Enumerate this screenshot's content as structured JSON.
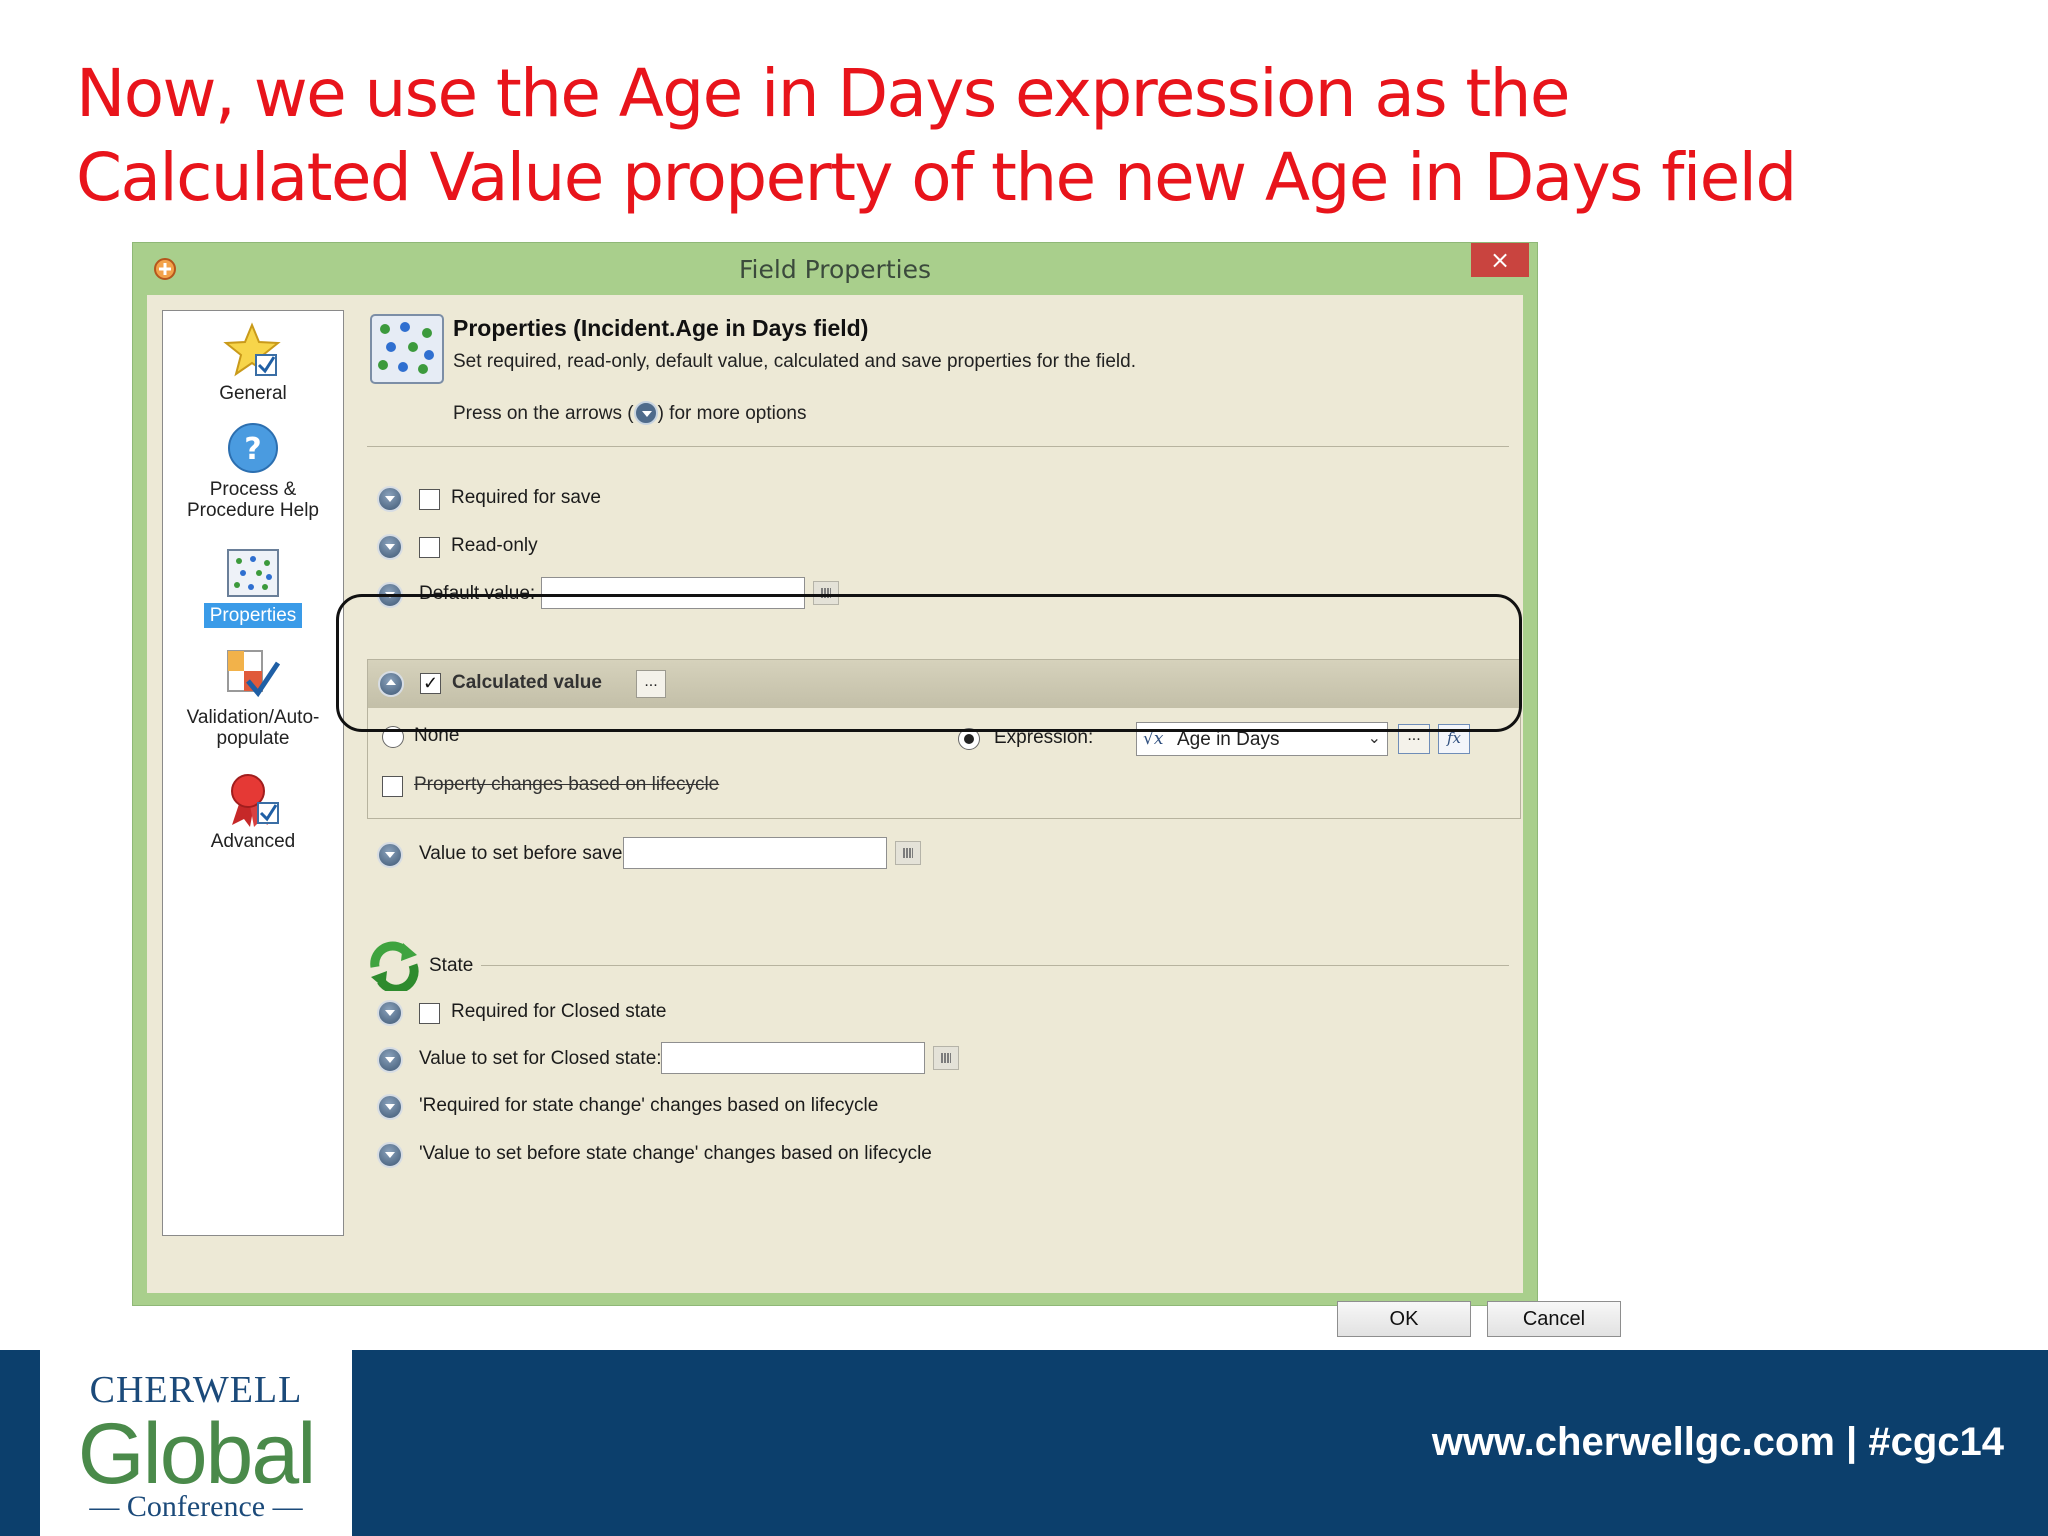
{
  "slide": {
    "title_line1": "Now, we use the Age in Days expression as the",
    "title_line2": "Calculated Value property of the new Age in Days field",
    "title_color": "#e8141b"
  },
  "dialog": {
    "title": "Field Properties",
    "close_label": "×",
    "nav": [
      {
        "label": "General",
        "icon": "star-check-icon"
      },
      {
        "label_line1": "Process &",
        "label_line2": "Procedure Help",
        "icon": "help-icon"
      },
      {
        "label": "Properties",
        "icon": "properties-grid-icon",
        "selected": true
      },
      {
        "label_line1": "Validation/Auto-",
        "label_line2": "populate",
        "icon": "validation-check-icon"
      },
      {
        "label": "Advanced",
        "icon": "ribbon-award-icon"
      }
    ],
    "header": {
      "title": "Properties  (Incident.Age in Days field)",
      "subtitle": "Set required, read-only, default value, calculated and save properties for the field.",
      "hint_prefix": "Press on the arrows (",
      "hint_suffix": ") for more options"
    },
    "required_for_save": {
      "label": "Required for save",
      "checked": false
    },
    "read_only": {
      "label": "Read-only",
      "checked": false
    },
    "default_value": {
      "label": "Default value:",
      "value": ""
    },
    "calculated_value": {
      "label": "Calculated value",
      "checked": true,
      "checkmark": "✓",
      "more_label": "...",
      "none_label": "None",
      "expression_label": "Expression:",
      "expression_selected": "Age in Days",
      "expression_icon_label": "√x",
      "dropdown_glyph": "⌄",
      "edit_label": "...",
      "fx_label": "fx",
      "lifecycle_label": "Property changes based on lifecycle",
      "selected_option": "expression"
    },
    "value_before_save": {
      "label": "Value to set before save:",
      "value": ""
    },
    "state": {
      "section_label": "State",
      "required_closed": {
        "label": "Required for Closed state",
        "checked": false
      },
      "value_closed": {
        "label": "Value to set for Closed state:",
        "value": ""
      },
      "required_state_change": "'Required for state change' changes based on lifecycle",
      "value_state_change": "'Value to set before state change' changes based on lifecycle"
    },
    "buttons": {
      "ok": "OK",
      "cancel": "Cancel"
    }
  },
  "footer": {
    "logo_line1": "CHERWELL",
    "logo_line2": "Global",
    "logo_line3": "— Conference —",
    "url": "www.cherwellgc.com | #cgc14",
    "background_color": "#0c3f6c"
  }
}
